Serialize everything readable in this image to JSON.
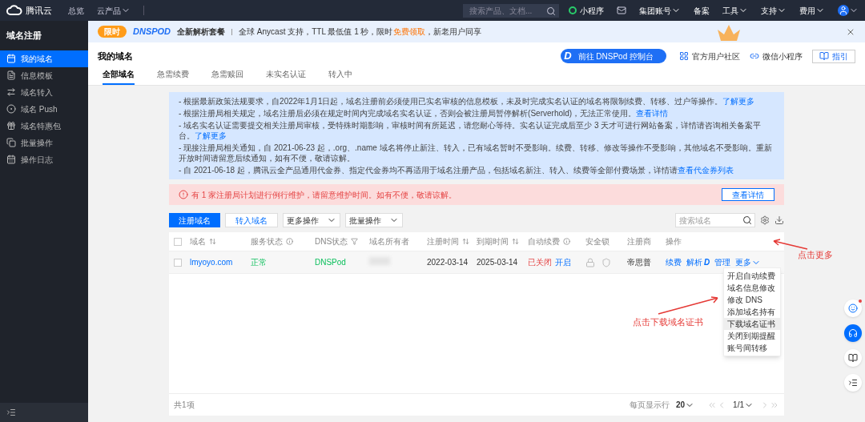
{
  "topbar": {
    "logo": "腾讯云",
    "nav": [
      {
        "label": "总览",
        "dropdown": false
      },
      {
        "label": "云产品",
        "dropdown": true
      }
    ],
    "search_placeholder": "搜索产品、文档...",
    "right": [
      {
        "kind": "miniapp",
        "label": "小程序"
      },
      {
        "kind": "mail"
      },
      {
        "kind": "text",
        "label": "集团账号",
        "dropdown": true
      },
      {
        "kind": "text",
        "label": "备案",
        "dropdown": false
      },
      {
        "kind": "text",
        "label": "工具",
        "dropdown": true
      },
      {
        "kind": "text",
        "label": "支持",
        "dropdown": true
      },
      {
        "kind": "text",
        "label": "费用",
        "dropdown": true
      },
      {
        "kind": "avatar",
        "dropdown": true
      }
    ]
  },
  "sidebar": {
    "title": "域名注册",
    "items": [
      {
        "label": "我的域名",
        "selected": true
      },
      {
        "label": "信息模板",
        "selected": false
      },
      {
        "label": "域名转入",
        "selected": false
      },
      {
        "label": "域名 Push",
        "selected": false
      },
      {
        "label": "域名特惠包",
        "selected": false
      },
      {
        "label": "批量操作",
        "selected": false
      },
      {
        "label": "操作日志",
        "selected": false
      }
    ]
  },
  "banner": {
    "badge": "限时",
    "brand": "DNSPOD",
    "title": "全新解析套餐",
    "text_before": "全球 Anycast 支持，TTL 最低值 1 秒，限时",
    "highlight": "免费领取",
    "text_after": "，新老用户同享"
  },
  "header": {
    "title": "我的域名",
    "dnspod_logo": "D",
    "dnspod_button": "前往 DNSPod 控制台",
    "links": [
      "官方用户社区",
      "微信小程序"
    ],
    "guide": "指引",
    "tabs": [
      {
        "label": "全部域名",
        "selected": true
      },
      {
        "label": "急需续费",
        "selected": false
      },
      {
        "label": "急需赎回",
        "selected": false
      },
      {
        "label": "未实名认证",
        "selected": false
      },
      {
        "label": "转入中",
        "selected": false
      }
    ]
  },
  "notices": [
    {
      "text": "- 根据最新政策法规要求，自2022年1月1日起，域名注册前必须使用已实名审核的信息模板，未及时完成实名认证的域名将限制续费、转移、过户等操作。",
      "link": "了解更多"
    },
    {
      "text": "- 根据注册局相关规定，域名注册后必须在规定时间内完成域名实名认证，否则会被注册局暂停解析(Serverhold)，无法正常使用。",
      "link": "查看详情"
    },
    {
      "text": "- 域名实名认证需要提交相关注册局审核，受特殊时期影响，审核时间有所延迟，请您耐心等待。实名认证完成后至少 3 天才可进行网站备案，详情请咨询相关备案平台。",
      "link": "了解更多"
    },
    {
      "text": "- 现接注册局相关通知，自 2021-06-23 起，.org、.name 域名将停止新注、转入，已有域名暂时不受影响。续费、转移、修改等操作不受影响，其他域名不受影响。重新开放时间请留意后续通知，如有不便，敬请谅解。"
    },
    {
      "text": "- 自 2021-06-18 起，腾讯云全产品通用代金券、指定代金券均不再适用于域名注册产品，包括域名新注、转入、续费等全部付费场景，详情请",
      "link": "查看代金券列表"
    }
  ],
  "alert": {
    "text": "有 1 家注册局计划进行例行维护，请留意维护时间。如有不便，敬请谅解。",
    "button": "查看详情"
  },
  "toolbar": {
    "buttons": [
      {
        "kind": "primary",
        "label": "注册域名"
      },
      {
        "kind": "outline",
        "label": "转入域名"
      },
      {
        "kind": "select",
        "label": "更多操作"
      },
      {
        "kind": "select",
        "label": "批量操作"
      }
    ],
    "search_placeholder": "搜索域名"
  },
  "table": {
    "header_checked": false,
    "columns": [
      {
        "label": "域名",
        "kind": "sort"
      },
      {
        "label": "服务状态",
        "kind": "info"
      },
      {
        "label": "DNS状态",
        "kind": "filter"
      },
      {
        "label": "域名所有者",
        "kind": "plain"
      },
      {
        "label": "注册时间",
        "kind": "sort"
      },
      {
        "label": "到期时间",
        "kind": "sort"
      },
      {
        "label": "自动续费",
        "kind": "info"
      },
      {
        "label": "安全锁",
        "kind": "plain"
      },
      {
        "label": "注册商",
        "kind": "plain"
      },
      {
        "label": "操作",
        "kind": "plain"
      }
    ],
    "rows": [
      {
        "checked": false,
        "domain": "lmyoyo.com",
        "status": "正常",
        "dns": "DNSPod",
        "registered": "2022-03-14",
        "expires": "2025-03-14",
        "auto_renew": {
          "on": false,
          "label": "已关闭",
          "action": "开启"
        },
        "registrar": "帝思普",
        "actions": [
          "续费",
          "解析",
          "管理"
        ],
        "dns_logo": "D",
        "more": "更多"
      }
    ],
    "menu": [
      {
        "label": "开启自动续费",
        "selected": false
      },
      {
        "label": "域名信息修改",
        "selected": false
      },
      {
        "label": "修改 DNS",
        "selected": false
      },
      {
        "label": "添加域名持有",
        "selected": false
      },
      {
        "label": "下载域名证书",
        "selected": true
      },
      {
        "label": "关闭到期提醒",
        "selected": false
      },
      {
        "label": "账号间转移",
        "selected": false
      }
    ],
    "footer": {
      "total": "共1项",
      "per_page_label": "每页显示行",
      "per_page": "20",
      "page": "1/1"
    }
  },
  "annotations": [
    "点击更多",
    "点击下载域名证书"
  ]
}
